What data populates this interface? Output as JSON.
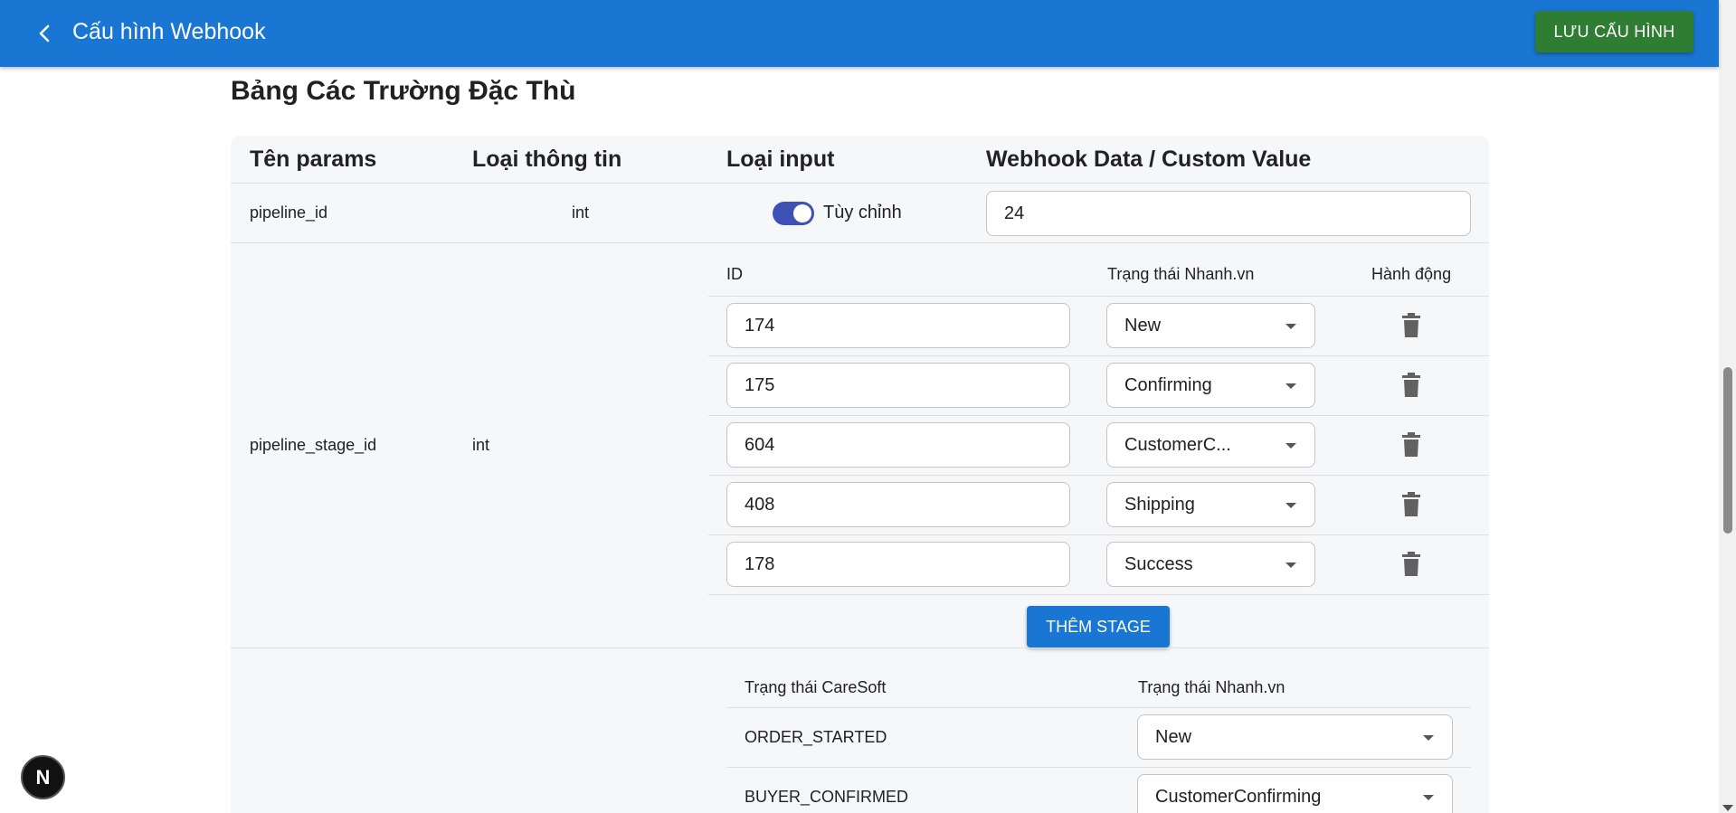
{
  "appbar": {
    "title": "Cấu hình Webhook",
    "save_label": "LƯU CẤU HÌNH",
    "color": "#1976d2",
    "save_color": "#2e7d32"
  },
  "section_title": "Bảng Các Trường Đặc Thù",
  "table": {
    "headers": [
      "Tên params",
      "Loại thông tin",
      "Loại input",
      "Webhook Data / Custom Value"
    ],
    "rows": [
      {
        "param": "pipeline_id",
        "type": "int",
        "toggle_label": "Tùy chỉnh",
        "toggle_on": true,
        "value": "24"
      },
      {
        "param": "pipeline_stage_id",
        "type": "int",
        "stage_headers": [
          "ID",
          "Trạng thái Nhanh.vn",
          "Hành động"
        ],
        "stages": [
          {
            "id": "174",
            "status": "New"
          },
          {
            "id": "175",
            "status": "Confirming"
          },
          {
            "id": "604",
            "status": "CustomerC..."
          },
          {
            "id": "408",
            "status": "Shipping"
          },
          {
            "id": "178",
            "status": "Success"
          }
        ],
        "add_stage_label": "THÊM STAGE"
      },
      {
        "mapping_headers": [
          "Trạng thái CareSoft",
          "Trạng thái Nhanh.vn"
        ],
        "mappings": [
          {
            "caresoft": "ORDER_STARTED",
            "nhanh": "New"
          },
          {
            "caresoft": "BUYER_CONFIRMED",
            "nhanh": "CustomerConfirming"
          }
        ]
      }
    ]
  },
  "icons": {
    "back": "arrow-back-icon",
    "delete": "trash-icon",
    "dropdown": "chevron-down-icon",
    "dev_badge": "N"
  }
}
